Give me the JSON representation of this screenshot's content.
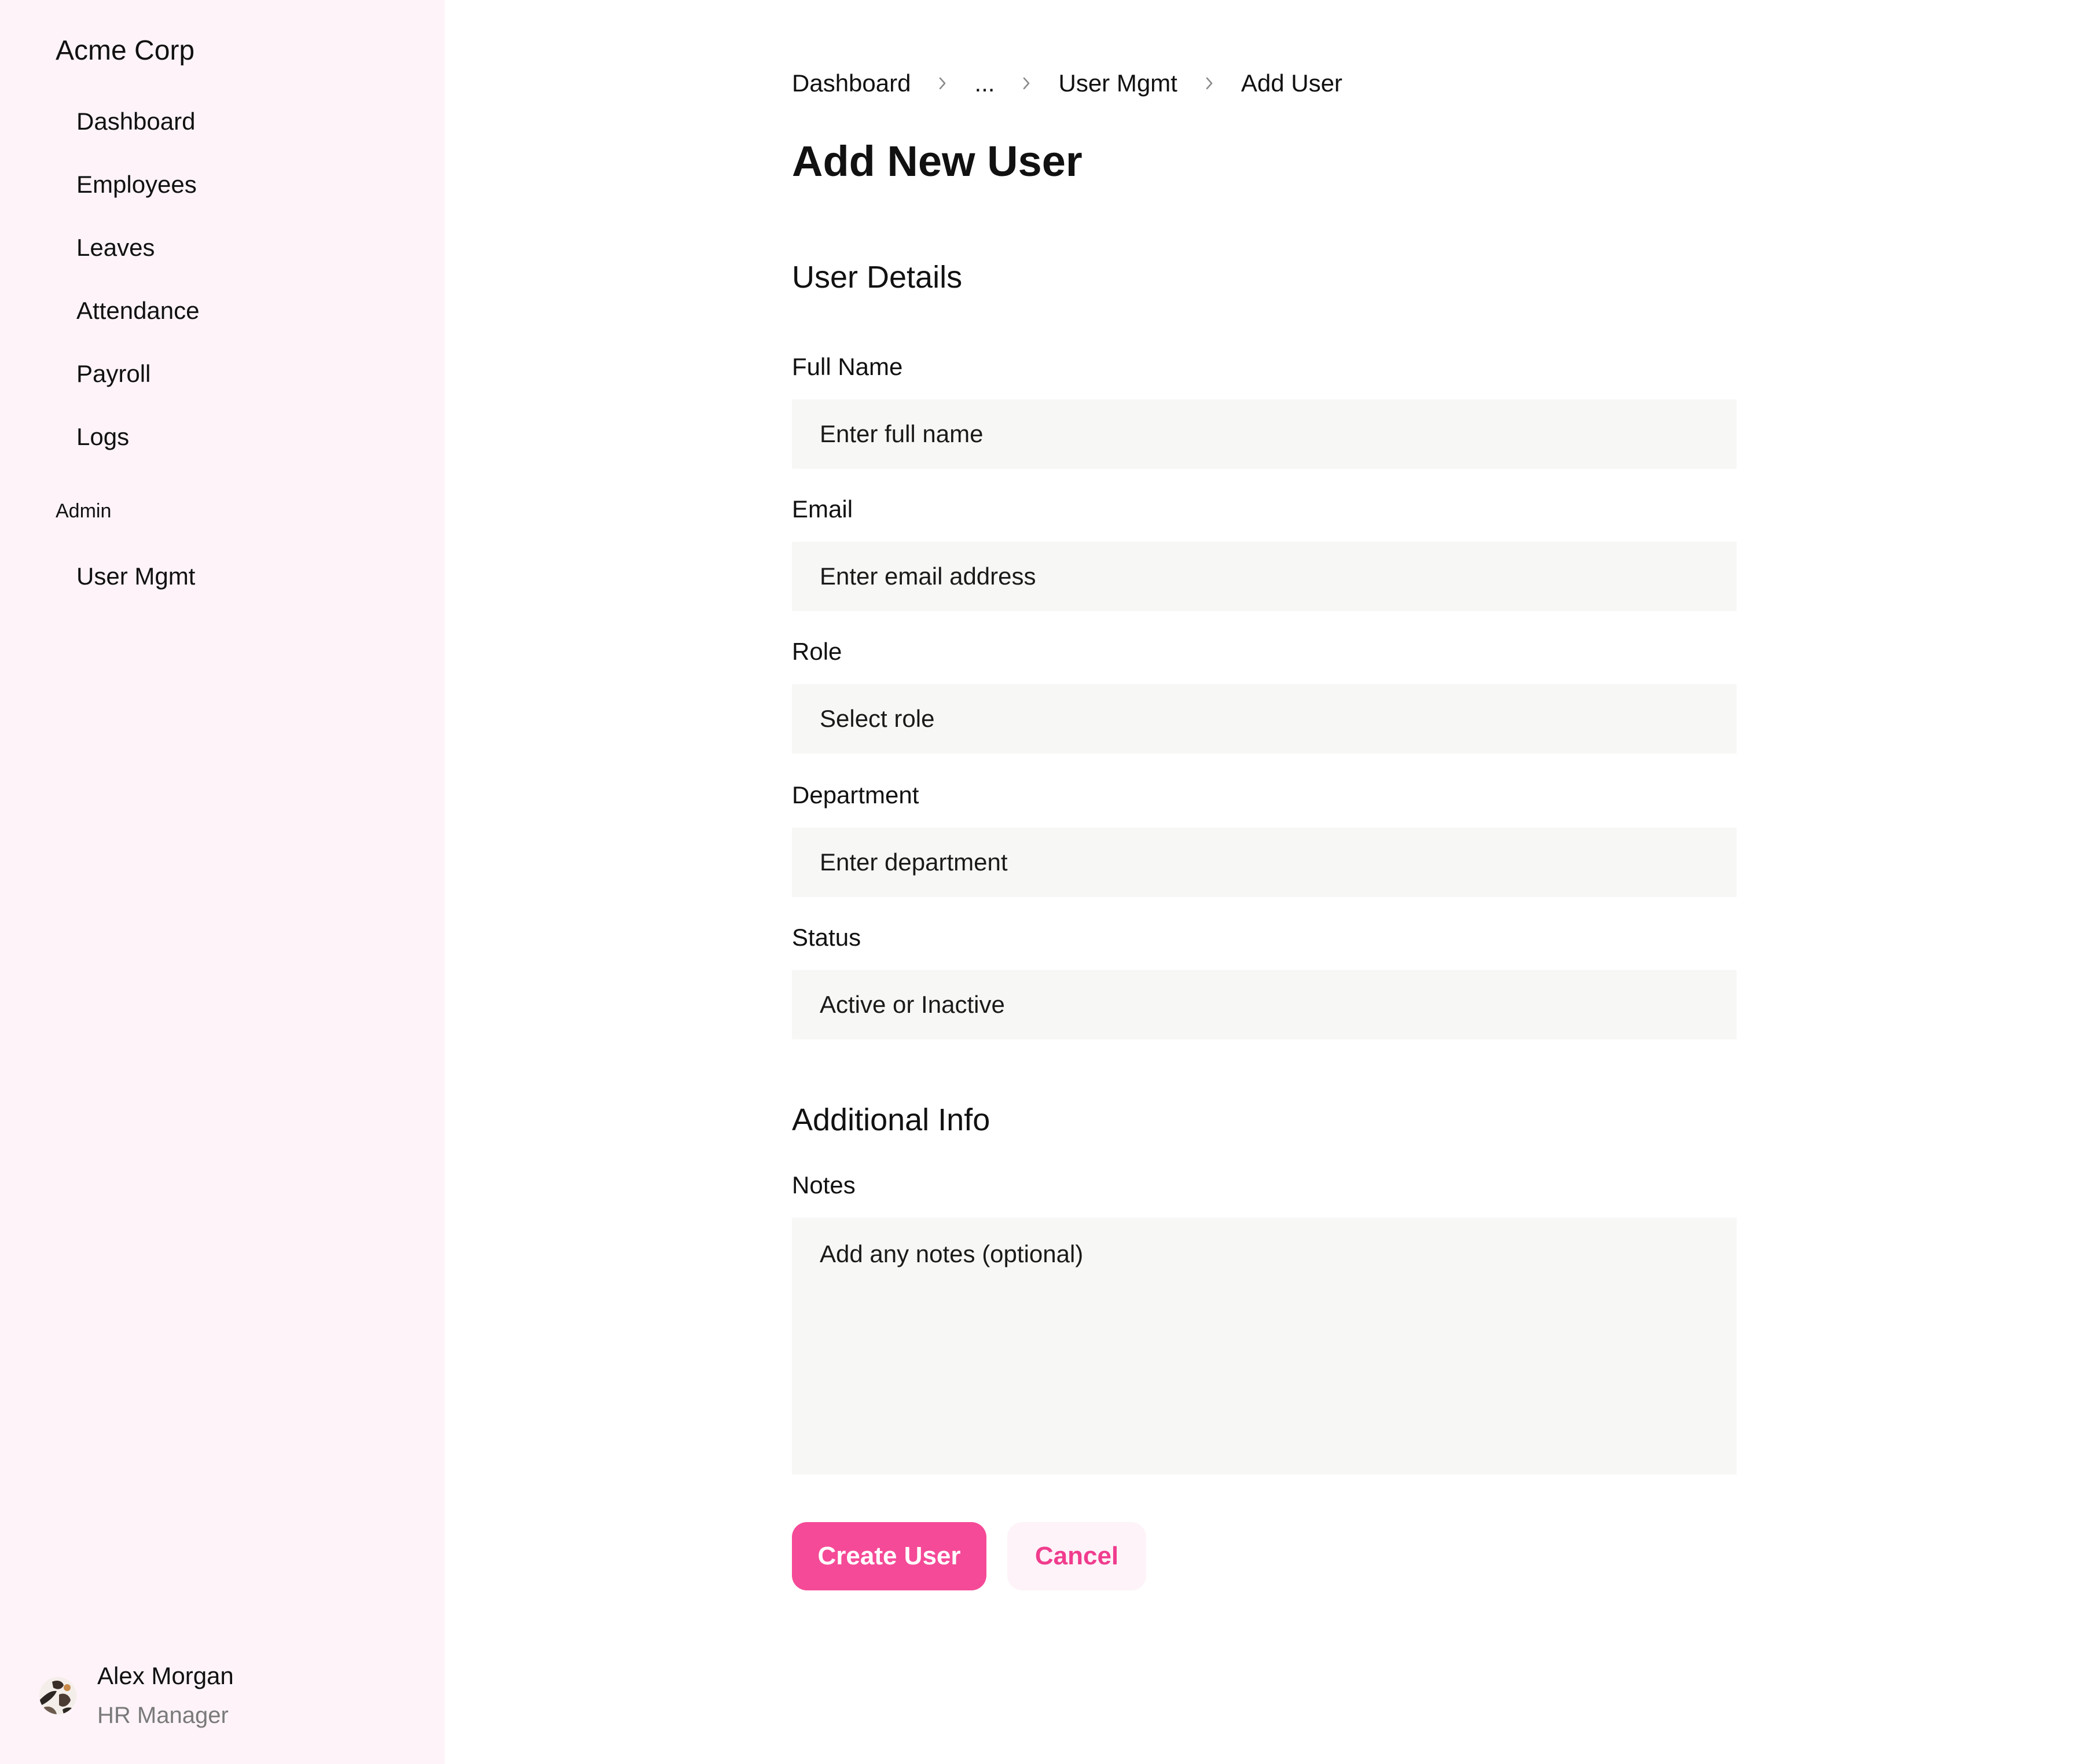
{
  "sidebar": {
    "brand": "Acme Corp",
    "items": [
      {
        "label": "Dashboard"
      },
      {
        "label": "Employees"
      },
      {
        "label": "Leaves"
      },
      {
        "label": "Attendance"
      },
      {
        "label": "Payroll"
      },
      {
        "label": "Logs"
      }
    ],
    "admin_section": {
      "title": "Admin",
      "items": [
        {
          "label": "User Mgmt"
        }
      ]
    },
    "user": {
      "name": "Alex Morgan",
      "role": "HR Manager"
    }
  },
  "breadcrumb": {
    "items": [
      "Dashboard",
      "...",
      "User Mgmt",
      "Add User"
    ]
  },
  "page": {
    "title": "Add New User"
  },
  "form": {
    "user_details": {
      "title": "User Details",
      "fields": [
        {
          "label": "Full Name",
          "placeholder": "Enter full name",
          "value": ""
        },
        {
          "label": "Email",
          "placeholder": "Enter email address",
          "value": ""
        },
        {
          "label": "Role",
          "placeholder": "Select role",
          "value": ""
        },
        {
          "label": "Department",
          "placeholder": "Enter department",
          "value": ""
        },
        {
          "label": "Status",
          "placeholder": "Active or Inactive",
          "value": ""
        }
      ]
    },
    "additional_info": {
      "title": "Additional Info",
      "notes": {
        "label": "Notes",
        "placeholder": "Add any notes (optional)",
        "value": ""
      }
    }
  },
  "actions": {
    "create_label": "Create User",
    "cancel_label": "Cancel"
  },
  "theme": {
    "accent": "#f54a97",
    "accent_text": "#f03c8e",
    "sidebar_bg": "#fdf3f8",
    "field_bg": "#f7f7f5"
  },
  "icons": {
    "breadcrumb_separator": "chevron-right-icon",
    "avatar": "user-avatar-image"
  }
}
